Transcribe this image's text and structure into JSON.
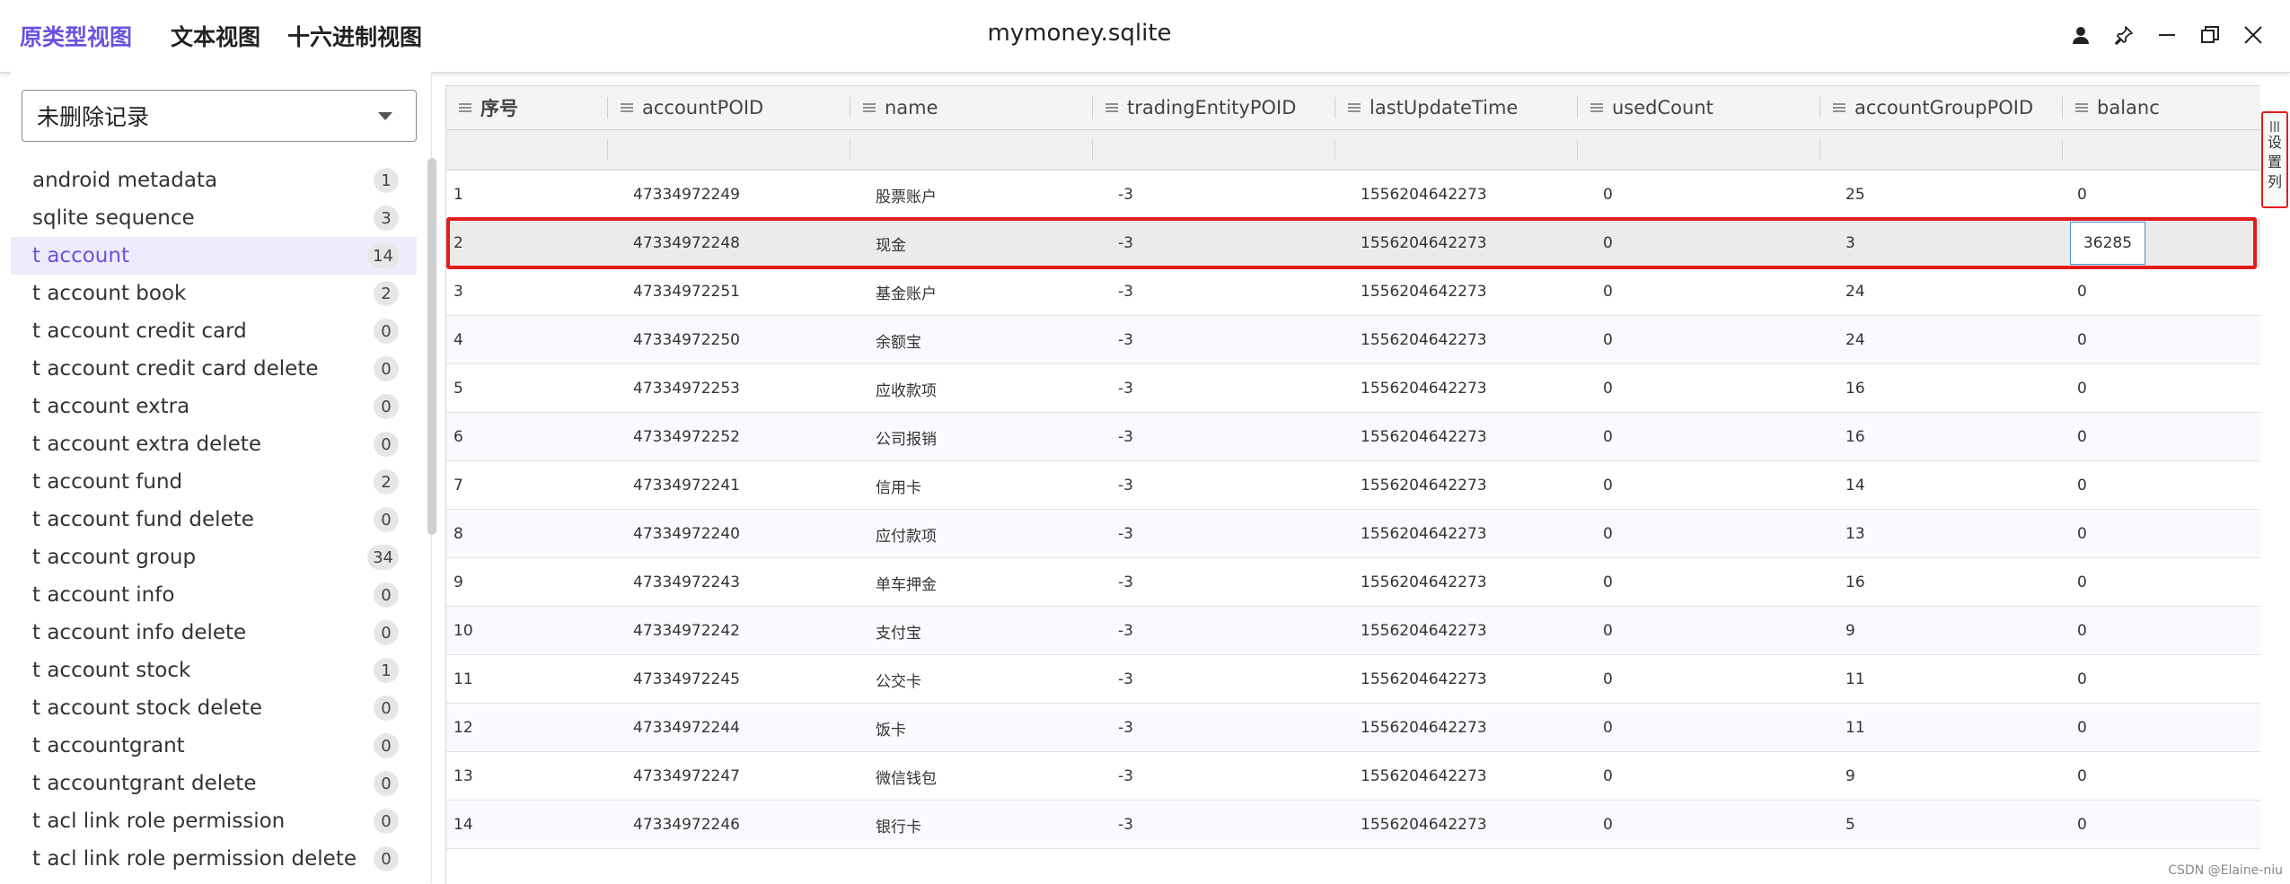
{
  "header": {
    "view_tabs": [
      "原类型视图",
      "文本视图",
      "十六进制视图"
    ],
    "active_tab_index": 0,
    "title": "mymoney.sqlite",
    "accent_color": "#6b52e0"
  },
  "sidebar": {
    "filter_value": "未删除记录",
    "tables": [
      {
        "name": "android metadata",
        "count": "1"
      },
      {
        "name": "sqlite sequence",
        "count": "3"
      },
      {
        "name": "t account",
        "count": "14",
        "selected": true
      },
      {
        "name": "t account book",
        "count": "2"
      },
      {
        "name": "t account credit card",
        "count": "0"
      },
      {
        "name": "t account credit card delete",
        "count": "0"
      },
      {
        "name": "t account extra",
        "count": "0"
      },
      {
        "name": "t account extra delete",
        "count": "0"
      },
      {
        "name": "t account fund",
        "count": "2"
      },
      {
        "name": "t account fund delete",
        "count": "0"
      },
      {
        "name": "t account group",
        "count": "34"
      },
      {
        "name": "t account info",
        "count": "0"
      },
      {
        "name": "t account info delete",
        "count": "0"
      },
      {
        "name": "t account stock",
        "count": "1"
      },
      {
        "name": "t account stock delete",
        "count": "0"
      },
      {
        "name": "t accountgrant",
        "count": "0"
      },
      {
        "name": "t accountgrant delete",
        "count": "0"
      },
      {
        "name": "t acl link role permission",
        "count": "0"
      },
      {
        "name": "t acl link role permission delete",
        "count": "0"
      }
    ]
  },
  "grid": {
    "columns": [
      "序号",
      "accountPOID",
      "name",
      "tradingEntityPOID",
      "lastUpdateTime",
      "usedCount",
      "accountGroupPOID",
      "balanc"
    ],
    "rows": [
      [
        "1",
        "47334972249",
        "股票账户",
        "-3",
        "1556204642273",
        "0",
        "25",
        "0"
      ],
      [
        "2",
        "47334972248",
        "现金",
        "-3",
        "1556204642273",
        "0",
        "3",
        "36285"
      ],
      [
        "3",
        "47334972251",
        "基金账户",
        "-3",
        "1556204642273",
        "0",
        "24",
        "0"
      ],
      [
        "4",
        "47334972250",
        "余额宝",
        "-3",
        "1556204642273",
        "0",
        "24",
        "0"
      ],
      [
        "5",
        "47334972253",
        "应收款项",
        "-3",
        "1556204642273",
        "0",
        "16",
        "0"
      ],
      [
        "6",
        "47334972252",
        "公司报销",
        "-3",
        "1556204642273",
        "0",
        "16",
        "0"
      ],
      [
        "7",
        "47334972241",
        "信用卡",
        "-3",
        "1556204642273",
        "0",
        "14",
        "0"
      ],
      [
        "8",
        "47334972240",
        "应付款项",
        "-3",
        "1556204642273",
        "0",
        "13",
        "0"
      ],
      [
        "9",
        "47334972243",
        "单车押金",
        "-3",
        "1556204642273",
        "0",
        "16",
        "0"
      ],
      [
        "10",
        "47334972242",
        "支付宝",
        "-3",
        "1556204642273",
        "0",
        "9",
        "0"
      ],
      [
        "11",
        "47334972245",
        "公交卡",
        "-3",
        "1556204642273",
        "0",
        "11",
        "0"
      ],
      [
        "12",
        "47334972244",
        "饭卡",
        "-3",
        "1556204642273",
        "0",
        "11",
        "0"
      ],
      [
        "13",
        "47334972247",
        "微信钱包",
        "-3",
        "1556204642273",
        "0",
        "9",
        "0"
      ],
      [
        "14",
        "47334972246",
        "银行卡",
        "-3",
        "1556204642273",
        "0",
        "5",
        "0"
      ]
    ],
    "highlighted_row_index": 1,
    "highlight_color": "#e31b1b"
  },
  "settings_tab": {
    "label_chars": [
      "设",
      "置",
      "列"
    ]
  },
  "watermark": "CSDN @Elaine-niu"
}
